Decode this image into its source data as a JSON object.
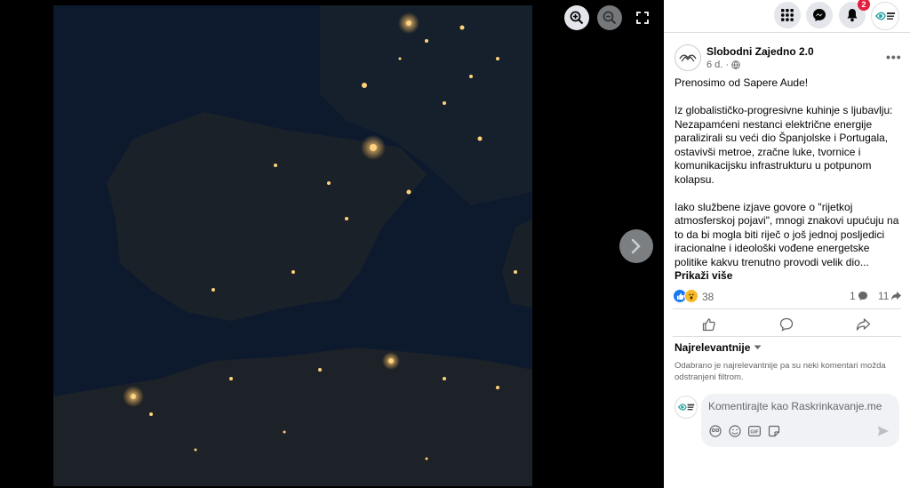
{
  "viewer": {
    "controls": {
      "zoom_in_icon": "zoom-in-icon",
      "zoom_out_icon": "zoom-out-icon",
      "fullscreen_icon": "fullscreen-icon",
      "next_icon": "chevron-right-icon"
    }
  },
  "topbar": {
    "menu_icon": "grid-menu-icon",
    "messenger_icon": "messenger-icon",
    "notifications_icon": "bell-icon",
    "notifications_count": "2",
    "account_icon": "account-avatar"
  },
  "post": {
    "page_name": "Slobodni Zajedno 2.0",
    "time": "6 d. ·",
    "paragraphs": [
      "Prenosimo od Sapere Aude!",
      "Iz globalističko-progresivne kuhinje s ljubavlju: Nezapamćeni nestanci električne energije paralizirali su veći dio Španjolske i Portugala, ostavivši metroe, zračne luke, tvornice i komunikacijsku infrastrukturu u potpunom kolapsu."
    ],
    "last_paragraph": "Iako službene izjave govore o \"rijetkoj atmosferskoj pojavi\", mnogi znakovi upućuju na to da bi mogla biti riječ o još jednoj posljedici iracionalne i ideološki vođene energetske politike kakvu trenutno provodi velik dio...",
    "see_more": "Prikaži više",
    "reaction_count": "38",
    "comment_count": "1",
    "share_count": "11"
  },
  "comments": {
    "sort_label": "Najrelevantnije",
    "sort_note": "Odabrano je najrelevantnije pa su neki komentari možda odstranjeni filtrom.",
    "placeholder": "Komentirajte kao Raskrinkavanje.me"
  },
  "colors": {
    "accent": "#1877f2",
    "notification": "#e41e3f"
  }
}
